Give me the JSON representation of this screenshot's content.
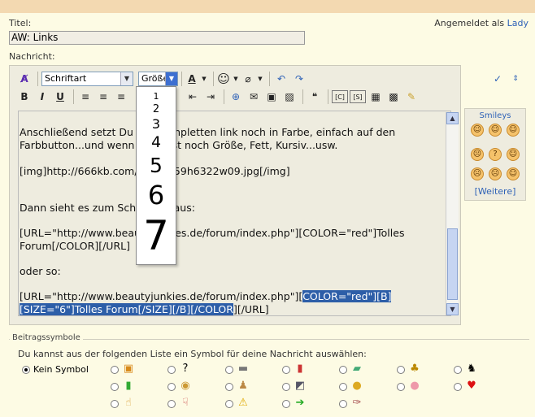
{
  "header": {
    "title_label": "Titel:",
    "title_value": "AW: Links",
    "message_label": "Nachricht:",
    "login_prefix": "Angemeldet als",
    "login_user": "Lady"
  },
  "toolbar": {
    "font_select": "Schriftart",
    "size_select": "Größe",
    "bold": "B",
    "italic": "I",
    "underline": "U"
  },
  "size_dropdown": {
    "options": [
      "1",
      "2",
      "3",
      "4",
      "5",
      "6",
      "7"
    ]
  },
  "message_lines": [
    "Anschließend setzt Du den kompletten link noch in Farbe, einfach auf den",
    "Farbbutton...und wenn Du willst noch Größe, Fett, Kursiv...usw.",
    "[img]http://666kb.com/i/azceu59h6322w09.jpg[/img]",
    "Dann sieht es zum Schluss so aus:",
    "[URL=\"http://www.beautyjunkies.de/forum/index.php\"][COLOR=\"red\"]Tolles",
    "Forum[/COLOR][/URL]",
    "oder so:",
    "[URL=\"http://www.beautyjunkies.de/forum/index.php\"][",
    "COLOR=\"red\"][B]",
    "[SIZE=\"6\"]Tolles Forum[/SIZE][/B][/COLOR",
    "][/URL]"
  ],
  "smileys": {
    "title": "Smileys",
    "more": "[Weitere]",
    "faces": [
      "☺",
      "☺",
      "☺",
      "☹",
      "?",
      "☺",
      "☹",
      "☹",
      "☺"
    ]
  },
  "post_icons": {
    "legend": "Beitragssymbole",
    "hint": "Du kannst aus der folgenden Liste ein Symbol für deine Nachricht auswählen:",
    "none_label": "Kein Symbol"
  }
}
